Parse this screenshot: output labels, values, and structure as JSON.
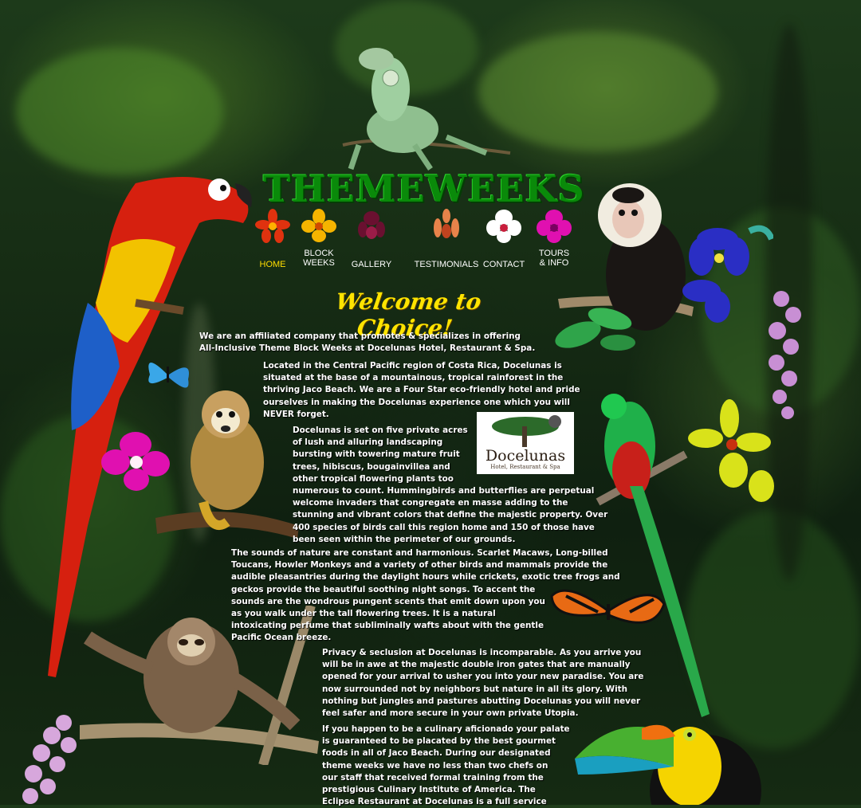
{
  "site": {
    "title": "THEMEWEEKS",
    "welcome": "Welcome to Choice!"
  },
  "nav": [
    {
      "label_line1": "",
      "label_line2": "HOME",
      "icon": "red-orchid-icon",
      "active": true
    },
    {
      "label_line1": "BLOCK",
      "label_line2": "WEEKS",
      "icon": "yellow-orchid-icon",
      "active": false
    },
    {
      "label_line1": "",
      "label_line2": "GALLERY",
      "icon": "purple-orchid-icon",
      "active": false
    },
    {
      "label_line1": "",
      "label_line2": "TESTIMONIALS",
      "icon": "orange-orchid-icon",
      "active": false
    },
    {
      "label_line1": "",
      "label_line2": "CONTACT",
      "icon": "white-orchid-icon",
      "active": false
    },
    {
      "label_line1": "TOURS",
      "label_line2": "& INFO",
      "icon": "magenta-orchid-icon",
      "active": false
    }
  ],
  "logo": {
    "word": "Docelunas",
    "subtitle": "Hotel, Restaurant & Spa"
  },
  "content": {
    "intro_1": "We are an affiliated company that promotes & specializes in offering",
    "intro_2": "All-Inclusive Theme Block Weeks at Docelunas Hotel, Restaurant & Spa.",
    "p1": [
      "Located in the Central Pacific region of Costa Rica, Docelunas is",
      "situated at the base of a mountainous, tropical rainforest in the",
      "thriving Jaco Beach. We are a Four Star eco-friendly hotel and pride",
      "ourselves in making the Docelunas experience one which you will",
      "NEVER forget."
    ],
    "p2": [
      "Docelunas is set on five private acres",
      "of lush and alluring landscaping",
      "bursting with towering mature fruit",
      "trees, hibiscus, bougainvillea and",
      "other tropical flowering plants too",
      "numerous to count. Hummingbirds and butterflies are perpetual",
      "welcome invaders that congregate en masse adding to the",
      "stunning and vibrant colors that define the majestic property. Over",
      "400 species of birds call this region home and 150 of those have",
      "been seen within the perimeter of our grounds."
    ],
    "p3": [
      "The sounds of nature are constant and harmonious. Scarlet Macaws, Long-billed",
      "Toucans, Howler Monkeys and a variety of other birds and mammals provide the",
      "audible pleasantries during the daylight hours while crickets, exotic tree frogs and",
      "geckos provide the beautiful soothing night songs. To accent the",
      "sounds are the wondrous pungent scents that emit down upon you",
      "as you walk under the tall flowering trees. It is a natural",
      "intoxicating perfume that subliminally wafts about with the gentle",
      "Pacific Ocean breeze."
    ],
    "p4": [
      "Privacy & seclusion at Docelunas is incomparable. As you arrive you",
      "will be in awe at the majestic double iron gates that are manually",
      "opened for your arrival to usher you into your new paradise. You are",
      "now surrounded not by neighbors but nature in all its glory. With",
      "nothing but jungles and pastures abutting Docelunas you will never",
      "feel safer and more secure in your own private Utopia."
    ],
    "p5": [
      "If you happen to be a culinary aficionado your palate",
      "is guaranteed to be placated by the best gourmet",
      "foods in all of Jaco Beach. During our designated",
      "theme weeks we have no less than two chefs on",
      "our staff that received formal training from the",
      "prestigious Culinary Institute of America. The",
      "Eclipse Restaurant at Docelunas is a full service"
    ]
  },
  "colors": {
    "title_green": "#0a8a0a",
    "nav_active": "#ffdd00",
    "welcome_yellow": "#ffe400"
  }
}
